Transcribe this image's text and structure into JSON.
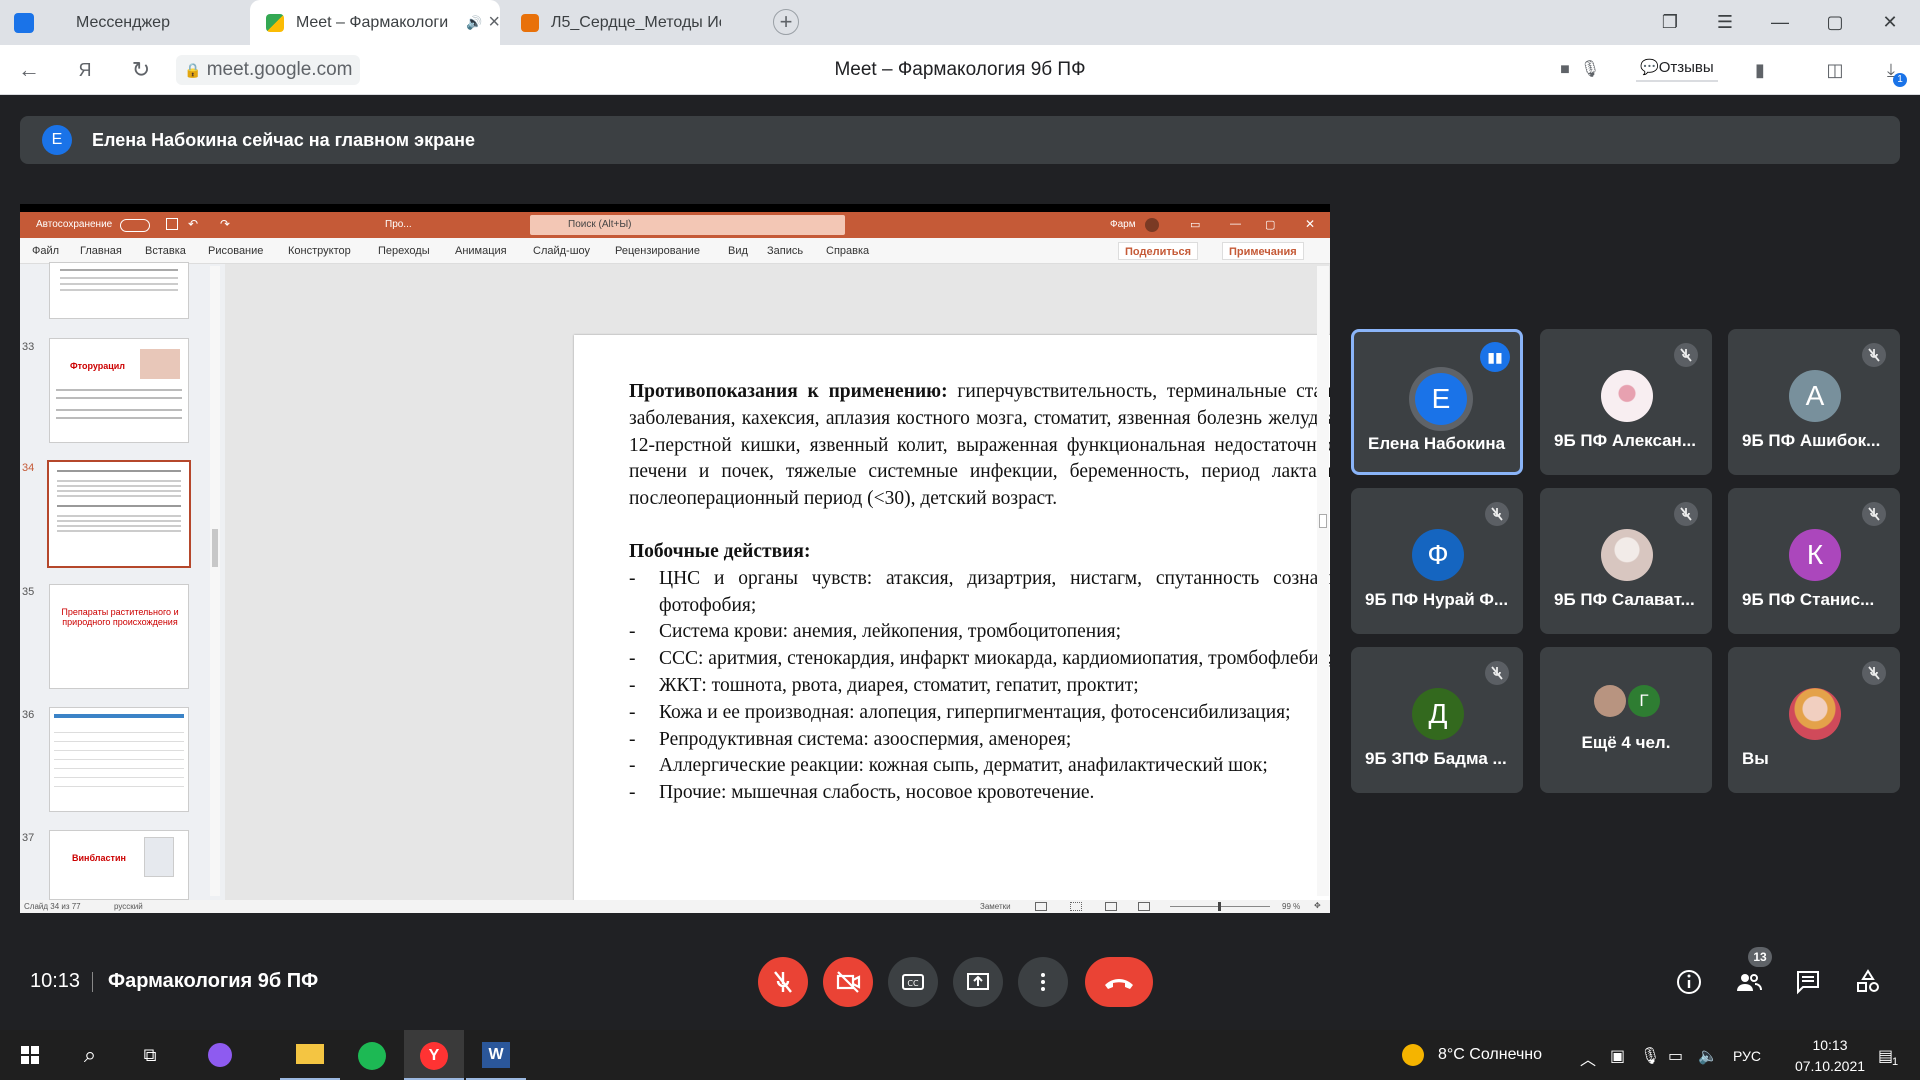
{
  "browser": {
    "tabs": [
      {
        "label": "Мессенджер"
      },
      {
        "label": "Meet – Фармакологи"
      },
      {
        "label": "Л5_Сердце_Методы Иссле"
      }
    ],
    "url": "meet.google.com",
    "page_title": "Meet – Фармакология 9б ПФ",
    "feedback_label": "Отзывы",
    "download_badge": "1"
  },
  "meet": {
    "banner_initial": "E",
    "banner_text": "Елена Набокина сейчас на главном экране",
    "time": "10:13",
    "meeting_name": "Фармакология 9б ПФ",
    "participants_count": "13",
    "tiles": [
      {
        "name": "Елена Набокина",
        "initial": "Е",
        "color": "#1a73e8",
        "speaking": true
      },
      {
        "name": "9Б ПФ Алексан...",
        "initial": "",
        "color": "#f3e6ea",
        "muted": true
      },
      {
        "name": "9Б ПФ Ашибок...",
        "initial": "А",
        "color": "#78909c",
        "muted": true
      },
      {
        "name": "9Б ПФ Нурай Ф...",
        "initial": "Ф",
        "color": "#1565c0",
        "muted": true
      },
      {
        "name": "9Б ПФ Салават...",
        "initial": "",
        "color": "#e8dcd8",
        "muted": true
      },
      {
        "name": "9Б ПФ Станис...",
        "initial": "К",
        "color": "#ab47bc",
        "muted": true
      },
      {
        "name": "9Б ЗПФ Бадма ...",
        "initial": "Д",
        "color": "#33691e",
        "muted": true
      },
      {
        "name": "Ещё 4 чел.",
        "initial": "Г",
        "color": "#2e7d32"
      },
      {
        "name": "Вы",
        "initial": "",
        "color": "#e5b7a8",
        "muted": true
      }
    ]
  },
  "ppt": {
    "autosave": "Автосохранение",
    "doc_short": "Про...",
    "search_placeholder": "Поиск (Alt+Ы)",
    "doc_right": "Фарм",
    "menu": [
      "Файл",
      "Главная",
      "Вставка",
      "Рисование",
      "Конструктор",
      "Переходы",
      "Анимация",
      "Слайд-шоу",
      "Рецензирование",
      "Вид",
      "Запись",
      "Справка"
    ],
    "share_label": "Поделиться",
    "comments_label": "Примечания",
    "thumbnails": [
      {
        "num": "33",
        "title": "Фторурацил"
      },
      {
        "num": "34",
        "title": ""
      },
      {
        "num": "35",
        "title": "Препараты растительного и природного происхождения"
      },
      {
        "num": "36",
        "title": ""
      },
      {
        "num": "37",
        "title": "Винбластин"
      }
    ],
    "status_left": "Слайд 34 из 77",
    "status_lang": "русский",
    "status_notes": "Заметки",
    "zoom": "99 %",
    "slide": {
      "contra_head": "Противопоказания к применению:",
      "contra_text": "гиперчувствительность, терминальные стадии заболевания, кахексия, аплазия костного мозга, стоматит, язвенная болезнь желудка и 12-перстной кишки, язвенный колит, выраженная функциональная недостаточность печени и почек, тяжелые системные инфекции, беременность, период лактации, послеоперационный период (<30), детский возраст.",
      "side_head": "Побочные действия:",
      "items": [
        "ЦНС и органы чувств: атаксия, дизартрия, нистагм, спутанность сознания, фотофобия;",
        "Система крови: анемия, лейкопения, тромбоцитопения;",
        "ССС: аритмия, стенокардия, инфаркт миокарда, кардиомиопатия, тромбофлебит;",
        "ЖКТ: тошнота, рвота, диарея, стоматит, гепатит, проктит;",
        "Кожа и ее производная: алопеция, гиперпигментация, фотосенсибилизация;",
        "Репродуктивная система: азооспермия, аменорея;",
        "Аллергические реакции: кожная сыпь, дерматит, анафилактический шок;",
        "Прочие: мышечная слабость, носовое кровотечение."
      ]
    }
  },
  "taskbar": {
    "weather": "8°C Солнечно",
    "lang": "РУС",
    "time": "10:13",
    "date": "07.10.2021",
    "notif_count": "1"
  }
}
